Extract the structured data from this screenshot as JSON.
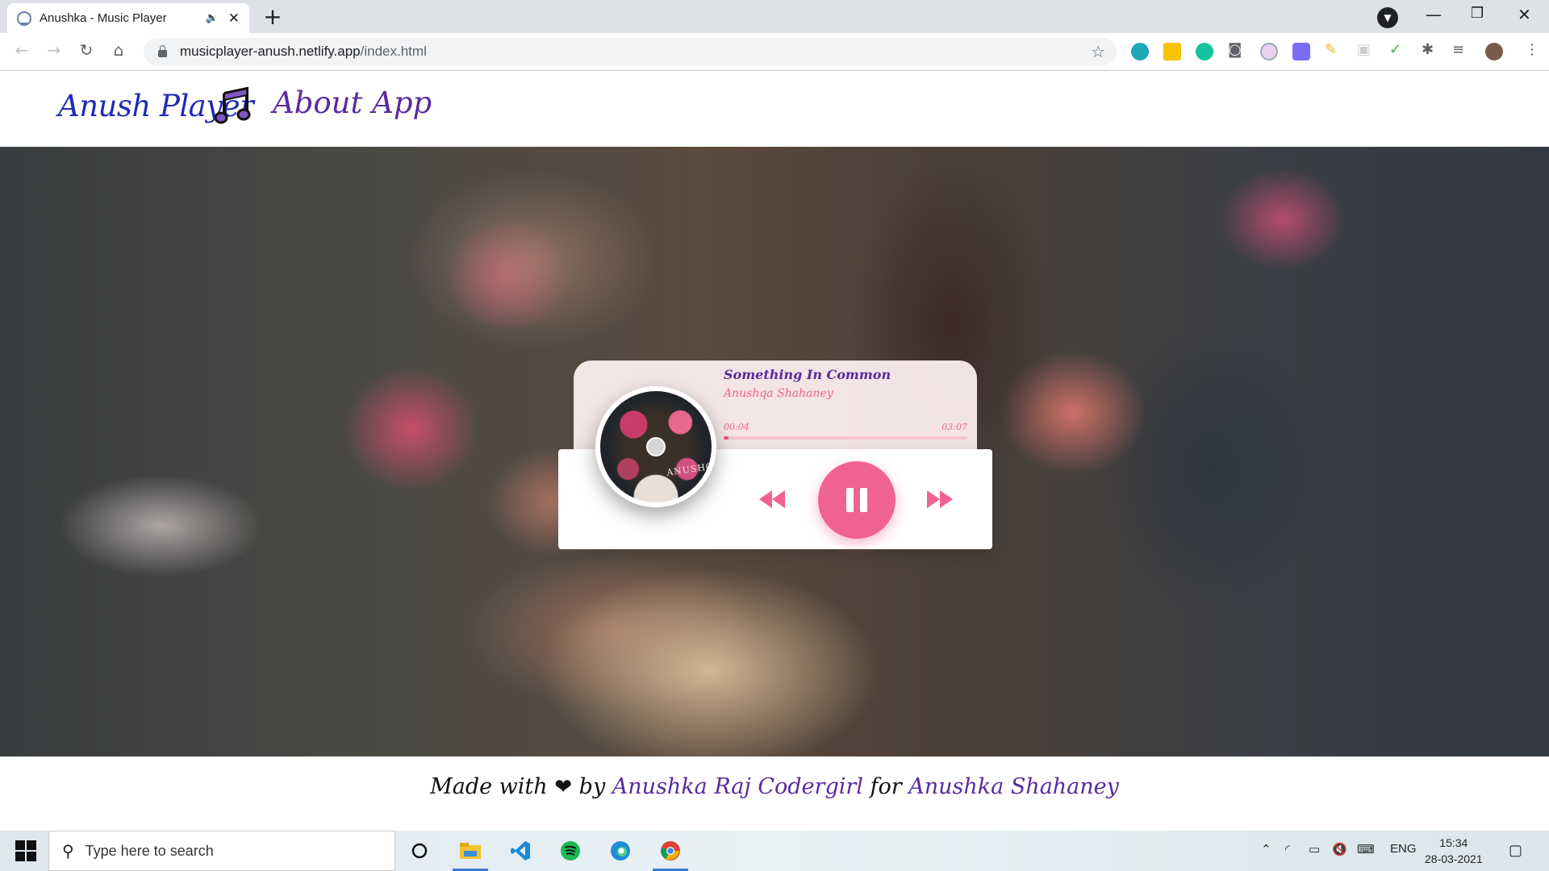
{
  "browser": {
    "tab_title": "Anushka - Music Player",
    "new_tab": "+",
    "url_host": "musicplayer-anush.netlify.app",
    "url_path": "/index.html"
  },
  "site": {
    "brand": "Anush Player",
    "nav_about": "About App"
  },
  "player": {
    "song_title": "Something In Common",
    "artist": "Anushqa Shahaney",
    "current_time": "00:04",
    "duration": "03:07",
    "progress": 0.02,
    "cover_text": "ANUSHQA"
  },
  "footer": {
    "made_with": "Made with",
    "heart": "❤",
    "by": "by",
    "author": "Anushka Raj Codergirl",
    "for": "for",
    "dedicatee": "Anushka Shahaney"
  },
  "taskbar": {
    "search_placeholder": "Type here to search",
    "lang": "ENG",
    "time": "15:34",
    "date": "28-03-2021"
  },
  "colors": {
    "accent": "#f06292",
    "purple": "#5a2a9e",
    "brand_blue": "#1f2ab8"
  }
}
